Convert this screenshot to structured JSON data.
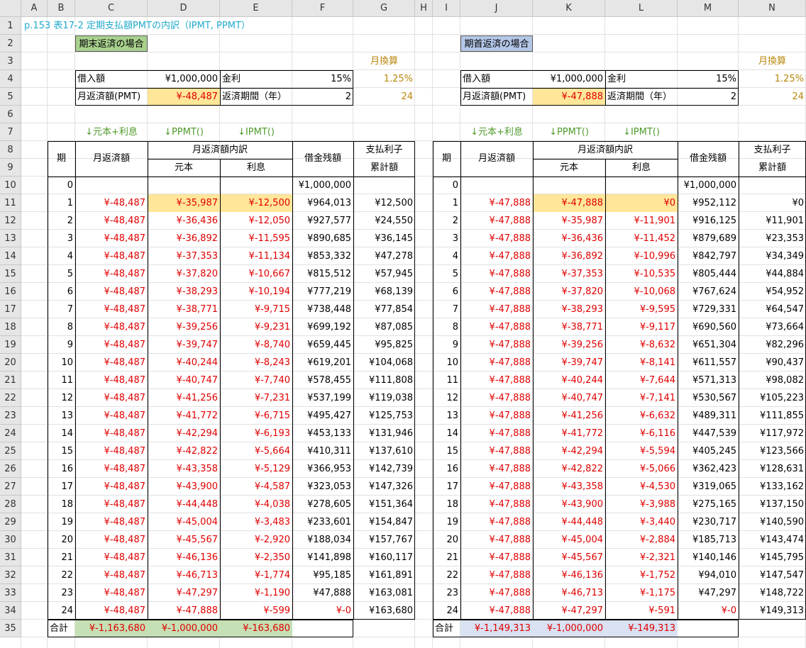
{
  "col_headers": [
    "A",
    "B",
    "C",
    "D",
    "E",
    "F",
    "G",
    "H",
    "I",
    "J",
    "K",
    "L",
    "M",
    "N"
  ],
  "row_headers": [
    "1",
    "2",
    "3",
    "4",
    "5",
    "6",
    "7",
    "8",
    "9",
    "10",
    "11",
    "12",
    "13",
    "14",
    "15",
    "16",
    "17",
    "18",
    "19",
    "20",
    "21",
    "22",
    "23",
    "24",
    "25",
    "26",
    "27",
    "28",
    "29",
    "30",
    "31",
    "32",
    "33",
    "34",
    "35"
  ],
  "title": "p.153 表17-2 定期支払額PMTの内訳（IPMT, PPMT）",
  "labels": {
    "monthly_calc": "月換算",
    "loan_amount": "借入額",
    "interest": "金利",
    "monthly_payment": "月返済額(PMT)",
    "repay_period": "返済期間（年）",
    "arrow_total": "↓元本+利息",
    "arrow_ppmt": "↓PPMT()",
    "arrow_ipmt": "↓IPMT()",
    "period": "期",
    "monthly_repay": "月返済額",
    "breakdown": "月返済額内訳",
    "principal": "元本",
    "interest_col": "利息",
    "balance": "借金残額",
    "paid_interest_1": "支払利子",
    "paid_interest_2": "累計額",
    "total": "合計"
  },
  "left": {
    "heading": "期末返済の場合",
    "loan": "¥1,000,000",
    "rate": "15%",
    "rate_monthly": "1.25%",
    "pmt": "¥-48,487",
    "years": "2",
    "months": "24",
    "initial_balance": "¥1,000,000",
    "rows": [
      [
        "1",
        "¥-48,487",
        "¥-35,987",
        "¥-12,500",
        "¥964,013",
        "¥12,500"
      ],
      [
        "2",
        "¥-48,487",
        "¥-36,436",
        "¥-12,050",
        "¥927,577",
        "¥24,550"
      ],
      [
        "3",
        "¥-48,487",
        "¥-36,892",
        "¥-11,595",
        "¥890,685",
        "¥36,145"
      ],
      [
        "4",
        "¥-48,487",
        "¥-37,353",
        "¥-11,134",
        "¥853,332",
        "¥47,278"
      ],
      [
        "5",
        "¥-48,487",
        "¥-37,820",
        "¥-10,667",
        "¥815,512",
        "¥57,945"
      ],
      [
        "6",
        "¥-48,487",
        "¥-38,293",
        "¥-10,194",
        "¥777,219",
        "¥68,139"
      ],
      [
        "7",
        "¥-48,487",
        "¥-38,771",
        "¥-9,715",
        "¥738,448",
        "¥77,854"
      ],
      [
        "8",
        "¥-48,487",
        "¥-39,256",
        "¥-9,231",
        "¥699,192",
        "¥87,085"
      ],
      [
        "9",
        "¥-48,487",
        "¥-39,747",
        "¥-8,740",
        "¥659,445",
        "¥95,825"
      ],
      [
        "10",
        "¥-48,487",
        "¥-40,244",
        "¥-8,243",
        "¥619,201",
        "¥104,068"
      ],
      [
        "11",
        "¥-48,487",
        "¥-40,747",
        "¥-7,740",
        "¥578,455",
        "¥111,808"
      ],
      [
        "12",
        "¥-48,487",
        "¥-41,256",
        "¥-7,231",
        "¥537,199",
        "¥119,038"
      ],
      [
        "13",
        "¥-48,487",
        "¥-41,772",
        "¥-6,715",
        "¥495,427",
        "¥125,753"
      ],
      [
        "14",
        "¥-48,487",
        "¥-42,294",
        "¥-6,193",
        "¥453,133",
        "¥131,946"
      ],
      [
        "15",
        "¥-48,487",
        "¥-42,822",
        "¥-5,664",
        "¥410,311",
        "¥137,610"
      ],
      [
        "16",
        "¥-48,487",
        "¥-43,358",
        "¥-5,129",
        "¥366,953",
        "¥142,739"
      ],
      [
        "17",
        "¥-48,487",
        "¥-43,900",
        "¥-4,587",
        "¥323,053",
        "¥147,326"
      ],
      [
        "18",
        "¥-48,487",
        "¥-44,448",
        "¥-4,038",
        "¥278,605",
        "¥151,364"
      ],
      [
        "19",
        "¥-48,487",
        "¥-45,004",
        "¥-3,483",
        "¥233,601",
        "¥154,847"
      ],
      [
        "20",
        "¥-48,487",
        "¥-45,567",
        "¥-2,920",
        "¥188,034",
        "¥157,767"
      ],
      [
        "21",
        "¥-48,487",
        "¥-46,136",
        "¥-2,350",
        "¥141,898",
        "¥160,117"
      ],
      [
        "22",
        "¥-48,487",
        "¥-46,713",
        "¥-1,774",
        "¥95,185",
        "¥161,891"
      ],
      [
        "23",
        "¥-48,487",
        "¥-47,297",
        "¥-1,190",
        "¥47,888",
        "¥163,081"
      ],
      [
        "24",
        "¥-48,487",
        "¥-47,888",
        "¥-599",
        "¥-0",
        "¥163,680"
      ]
    ],
    "totals": [
      "¥-1,163,680",
      "¥-1,000,000",
      "¥-163,680"
    ]
  },
  "right": {
    "heading": "期首返済の場合",
    "loan": "¥1,000,000",
    "rate": "15%",
    "rate_monthly": "1.25%",
    "pmt": "¥-47,888",
    "years": "2",
    "months": "24",
    "initial_balance": "¥1,000,000",
    "rows": [
      [
        "1",
        "¥-47,888",
        "¥-47,888",
        "¥0",
        "¥952,112",
        "¥0"
      ],
      [
        "2",
        "¥-47,888",
        "¥-35,987",
        "¥-11,901",
        "¥916,125",
        "¥11,901"
      ],
      [
        "3",
        "¥-47,888",
        "¥-36,436",
        "¥-11,452",
        "¥879,689",
        "¥23,353"
      ],
      [
        "4",
        "¥-47,888",
        "¥-36,892",
        "¥-10,996",
        "¥842,797",
        "¥34,349"
      ],
      [
        "5",
        "¥-47,888",
        "¥-37,353",
        "¥-10,535",
        "¥805,444",
        "¥44,884"
      ],
      [
        "6",
        "¥-47,888",
        "¥-37,820",
        "¥-10,068",
        "¥767,624",
        "¥54,952"
      ],
      [
        "7",
        "¥-47,888",
        "¥-38,293",
        "¥-9,595",
        "¥729,331",
        "¥64,547"
      ],
      [
        "8",
        "¥-47,888",
        "¥-38,771",
        "¥-9,117",
        "¥690,560",
        "¥73,664"
      ],
      [
        "9",
        "¥-47,888",
        "¥-39,256",
        "¥-8,632",
        "¥651,304",
        "¥82,296"
      ],
      [
        "10",
        "¥-47,888",
        "¥-39,747",
        "¥-8,141",
        "¥611,557",
        "¥90,437"
      ],
      [
        "11",
        "¥-47,888",
        "¥-40,244",
        "¥-7,644",
        "¥571,313",
        "¥98,082"
      ],
      [
        "12",
        "¥-47,888",
        "¥-40,747",
        "¥-7,141",
        "¥530,567",
        "¥105,223"
      ],
      [
        "13",
        "¥-47,888",
        "¥-41,256",
        "¥-6,632",
        "¥489,311",
        "¥111,855"
      ],
      [
        "14",
        "¥-47,888",
        "¥-41,772",
        "¥-6,116",
        "¥447,539",
        "¥117,972"
      ],
      [
        "15",
        "¥-47,888",
        "¥-42,294",
        "¥-5,594",
        "¥405,245",
        "¥123,566"
      ],
      [
        "16",
        "¥-47,888",
        "¥-42,822",
        "¥-5,066",
        "¥362,423",
        "¥128,631"
      ],
      [
        "17",
        "¥-47,888",
        "¥-43,358",
        "¥-4,530",
        "¥319,065",
        "¥133,162"
      ],
      [
        "18",
        "¥-47,888",
        "¥-43,900",
        "¥-3,988",
        "¥275,165",
        "¥137,150"
      ],
      [
        "19",
        "¥-47,888",
        "¥-44,448",
        "¥-3,440",
        "¥230,717",
        "¥140,590"
      ],
      [
        "20",
        "¥-47,888",
        "¥-45,004",
        "¥-2,884",
        "¥185,713",
        "¥143,474"
      ],
      [
        "21",
        "¥-47,888",
        "¥-45,567",
        "¥-2,321",
        "¥140,146",
        "¥145,795"
      ],
      [
        "22",
        "¥-47,888",
        "¥-46,136",
        "¥-1,752",
        "¥94,010",
        "¥147,547"
      ],
      [
        "23",
        "¥-47,888",
        "¥-46,713",
        "¥-1,175",
        "¥47,297",
        "¥148,722"
      ],
      [
        "24",
        "¥-47,888",
        "¥-47,297",
        "¥-591",
        "¥-0",
        "¥149,313"
      ]
    ],
    "totals": [
      "¥-1,149,313",
      "¥-1,000,000",
      "¥-149,313"
    ]
  }
}
